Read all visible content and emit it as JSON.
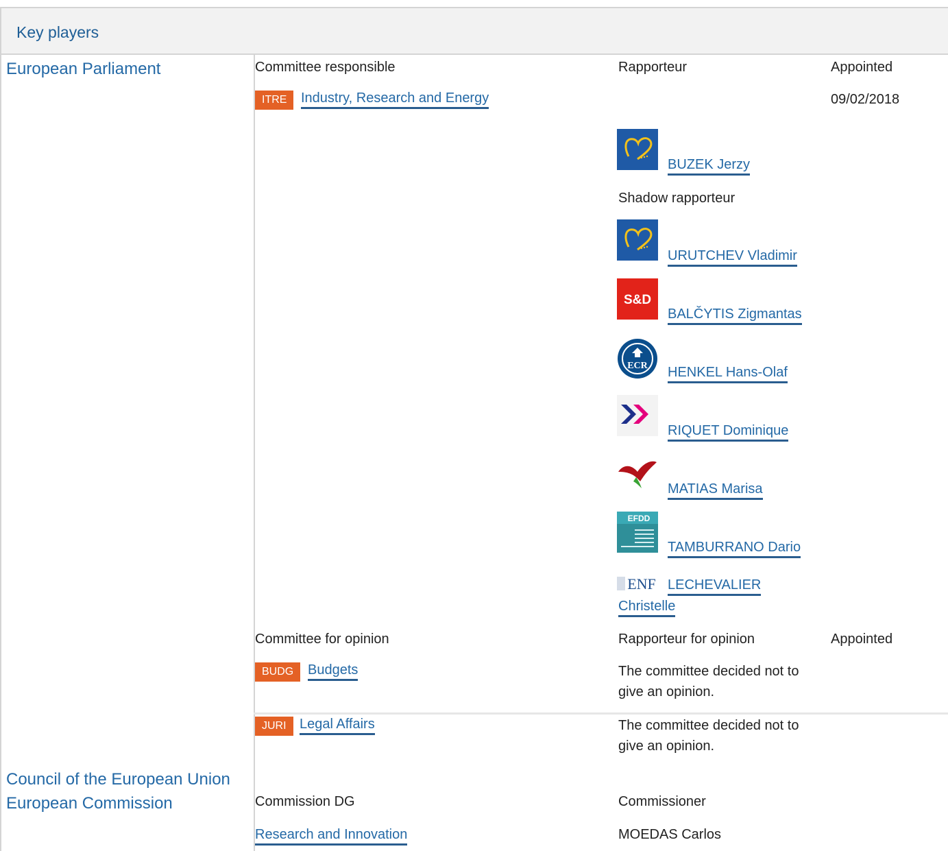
{
  "header": {
    "title": "Key players"
  },
  "institutions": {
    "parliament": "European Parliament",
    "council": "Council of the European Union",
    "commission": "European Commission"
  },
  "responsible": {
    "col_committee": "Committee responsible",
    "col_rapporteur": "Rapporteur",
    "col_appointed": "Appointed",
    "committee_code": "ITRE",
    "committee_name": "Industry, Research and Energy",
    "appointed_date": "09/02/2018",
    "rapporteur": {
      "name": "BUZEK Jerzy",
      "group_icon": "epp-logo-icon"
    },
    "shadow_label": "Shadow rapporteur",
    "shadows": [
      {
        "name": "URUTCHEV Vladimir",
        "group_icon": "epp-logo-icon"
      },
      {
        "name": "BALČYTIS Zigmantas",
        "group_icon": "sd-logo-icon",
        "logo_text": "S&D"
      },
      {
        "name": "HENKEL Hans-Olaf",
        "group_icon": "ecr-logo-icon",
        "logo_text": "ECR"
      },
      {
        "name": "RIQUET Dominique",
        "group_icon": "alde-logo-icon"
      },
      {
        "name": "MATIAS Marisa",
        "group_icon": "gue-ngl-logo-icon"
      },
      {
        "name": "TAMBURRANO Dario",
        "group_icon": "efdd-logo-icon",
        "logo_text": "EFDD"
      },
      {
        "name_part1": "LECHEVALIER",
        "name_part2": "Christelle",
        "group_icon": "enf-logo-icon",
        "logo_text": "ENF"
      }
    ]
  },
  "opinion": {
    "col_committee": "Committee for opinion",
    "col_rapporteur": "Rapporteur for opinion",
    "col_appointed": "Appointed",
    "rows": [
      {
        "code": "BUDG",
        "name": "Budgets",
        "text_line1": "The committee decided not to",
        "text_line2": "give an opinion."
      },
      {
        "code": "JURI",
        "name": "Legal Affairs",
        "text_line1": "The committee decided not to",
        "text_line2": "give an opinion."
      }
    ]
  },
  "commission": {
    "col_dg": "Commission DG",
    "col_commissioner": "Commissioner",
    "dg": "Research and Innovation",
    "commissioner": "MOEDAS Carlos"
  },
  "colors": {
    "link": "#2469a6",
    "badge": "#e46125",
    "header_bg": "#f2f2f2",
    "epp_blue": "#1f5aa6",
    "sd_red": "#e2231a"
  }
}
